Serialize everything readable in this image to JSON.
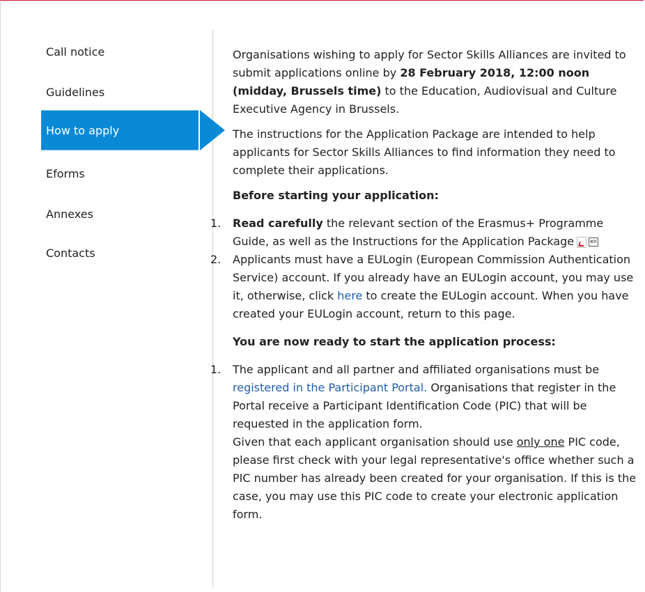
{
  "sidebar": {
    "items": [
      {
        "label": "Call notice"
      },
      {
        "label": "Guidelines"
      },
      {
        "label": "How to apply"
      },
      {
        "label": "Eforms"
      },
      {
        "label": "Annexes"
      },
      {
        "label": "Contacts"
      }
    ],
    "active_index": 2,
    "accent_color": "#0a8ad6"
  },
  "content": {
    "intro_pre": "Organisations wishing to apply for Sector Skills Alliances are invited to submit applications online by ",
    "intro_bold": "28 February 2018, 12:00 noon (midday, Brussels time)",
    "intro_post": " to the Education, Audiovisual and Culture Executive Agency in Brussels.",
    "instructions": "The instructions for the Application Package are intended to help applicants for Sector Skills Alliances to find information they need to complete their applications.",
    "before_heading": "Before starting your application:",
    "before_list": {
      "item1_num": "1.",
      "item1_bold": "Read carefully",
      "item1_text": " the relevant section of the Erasmus+ Programme Guide, as well as the Instructions for the Application Package",
      "item1_lang": "en",
      "item2_num": "2.",
      "item2_pre": "Applicants must have a EULogin (European Commission Authentication Service) account. If you already have an EULogin account, you may use it, otherwise, click ",
      "item2_link": "here",
      "item2_post": " to create the EULogin account. When you have created your EULogin account, return to this page."
    },
    "ready_heading": "You are now ready to start the application process:",
    "ready_list": {
      "item1_num": "1.",
      "item1_pre": "The applicant and all partner and affiliated organisations must be ",
      "item1_link": "registered in the Participant Portal.",
      "item1_post": " Organisations that register in the Portal receive a Participant Identification Code (PIC) that will be requested in the application form.",
      "item1_p2_pre": "Given that each applicant organisation should use ",
      "item1_p2_underline": "only one",
      "item1_p2_post": " PIC code, please first check with your legal representative's office whether such a PIC number has already been created for your organisation. If this is the case, you may use this PIC code to create your electronic application form."
    }
  }
}
